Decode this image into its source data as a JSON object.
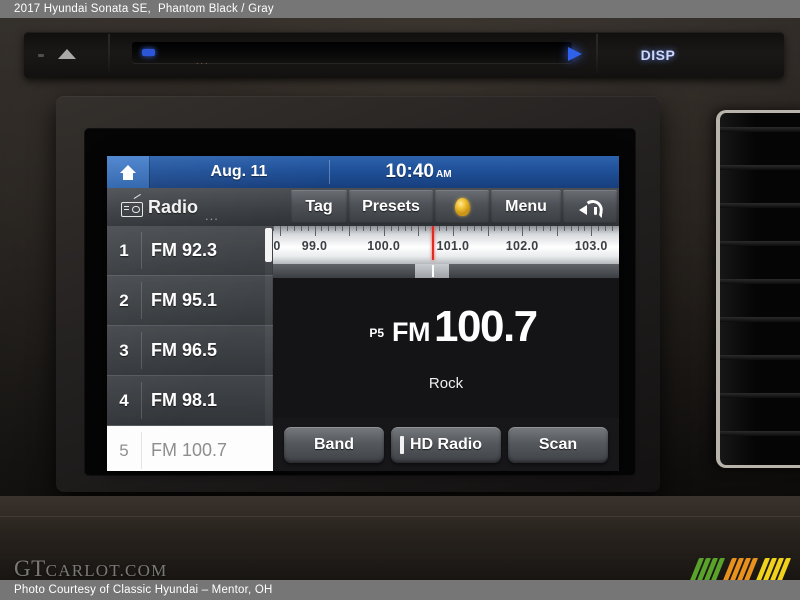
{
  "caption": {
    "top_year_model": "2017 Hyundai Sonata SE,",
    "top_colors": "Phantom Black / Gray",
    "bottom": "Photo Courtesy of Classic Hyundai – Mentor, OH"
  },
  "watermark": {
    "prefix": "GT",
    "suffix": "CARLOT.COM"
  },
  "dashboard": {
    "eject_icon": "eject-icon",
    "disp_label": "DISP",
    "cd_slot_dots": "...",
    "cd_led_icon": "blue-led-indicator",
    "cd_arrow_icon": "blue-arrow-icon",
    "vent_label": "air-vent"
  },
  "screen": {
    "status_bar": {
      "home_icon": "home-icon",
      "date": "Aug. 11",
      "time": "10:40",
      "ampm": "AM"
    },
    "tool_bar": {
      "source_icon": "radio-icon",
      "source_label": "Radio",
      "source_ellipsis": "...",
      "buttons": [
        {
          "label": "Tag",
          "name": "tag-button"
        },
        {
          "label": "Presets",
          "name": "presets-button"
        },
        {
          "label": "",
          "name": "hand-icon-button",
          "icon": "hand-icon"
        },
        {
          "label": "Menu",
          "name": "menu-button"
        },
        {
          "label": "",
          "name": "back-button",
          "icon": "back-arrow-icon"
        }
      ]
    },
    "presets": [
      {
        "num": "1",
        "freq": "FM 92.3",
        "selected": false
      },
      {
        "num": "2",
        "freq": "FM 95.1",
        "selected": false
      },
      {
        "num": "3",
        "freq": "FM 96.5",
        "selected": false
      },
      {
        "num": "4",
        "freq": "FM 98.1",
        "selected": false
      },
      {
        "num": "5",
        "freq": "FM 100.7",
        "selected": true
      }
    ],
    "tuner": {
      "scale_labels": [
        "0",
        "99.0",
        "100.0",
        "101.0",
        "102.0",
        "103.0"
      ],
      "needle_frequency": "100.7",
      "range_min": 98.4,
      "range_max": 103.4,
      "needle_color": "#e02a22"
    },
    "now_playing": {
      "preset_tag": "P5",
      "band": "FM",
      "frequency": "100.7",
      "genre": "Rock"
    },
    "controls": [
      {
        "label": "Band",
        "name": "band-button"
      },
      {
        "label": "HD Radio",
        "name": "hd-radio-button"
      },
      {
        "label": "Scan",
        "name": "scan-button"
      }
    ]
  },
  "colors": {
    "status_blue": "#1f4f97",
    "home_blue": "#2c63ab",
    "needle_red": "#e02a22",
    "hand_gold": "#f2c335",
    "caption_gray": "#767676",
    "logo_green": "#5aa32a",
    "logo_orange": "#e8921d",
    "logo_yellow": "#f0d21a"
  }
}
